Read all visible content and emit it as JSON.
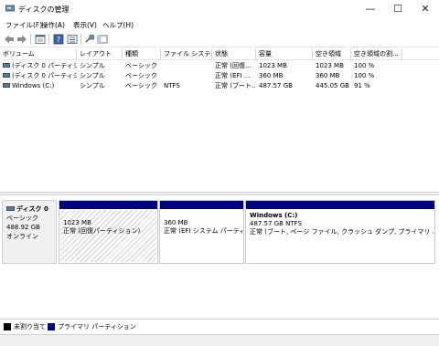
{
  "window": {
    "title": "ディスクの管理",
    "minimize": "—",
    "maximize": "☐",
    "close": "✕"
  },
  "menu": [
    "ファイル(F)",
    "操作(A)",
    "表示(V)",
    "ヘルプ(H)"
  ],
  "toolbar_icons": [
    "back-arrow-icon",
    "forward-arrow-icon",
    "properties-icon",
    "help-icon",
    "details-icon",
    "connect-icon",
    "console-icon"
  ],
  "columns": [
    "ボリューム",
    "レイアウト",
    "種類",
    "ファイル システム",
    "状態",
    "容量",
    "空き領域",
    "空き領域の割..."
  ],
  "volumes": [
    [
      "(ディスク 0 パーティショ...",
      "シンプル",
      "ベーシック",
      "",
      "正常 (回復...",
      "1023 MB",
      "1023 MB",
      "100 %"
    ],
    [
      "(ディスク 0 パーティショ...",
      "シンプル",
      "ベーシック",
      "",
      "正常 (EFI ...",
      "360 MB",
      "360 MB",
      "100 %"
    ],
    [
      "Windows (C:)",
      "シンプル",
      "ベーシック",
      "NTFS",
      "正常 (ブート...",
      "487.57 GB",
      "445.05 GB",
      "91 %"
    ]
  ],
  "disk": {
    "name": "ディスク 0",
    "type": "ベーシック",
    "size": "488.92 GB",
    "status": "オンライン"
  },
  "partitions": [
    {
      "title": "",
      "size": "1023 MB",
      "status": "正常 (回復パーティション)"
    },
    {
      "title": "",
      "size": "360 MB",
      "status": "正常 (EFI システム パーティシ"
    },
    {
      "title": "Windows (C:)",
      "size": "487.57 GB NTFS",
      "status": "正常 (ブート, ページ ファイル, クラッシュ ダンプ, プライマリ パーティション)"
    }
  ],
  "legend": [
    {
      "label": "未割り当て",
      "color": "#000000"
    },
    {
      "label": "プライマリ パーティション",
      "color": "#00007f"
    }
  ]
}
